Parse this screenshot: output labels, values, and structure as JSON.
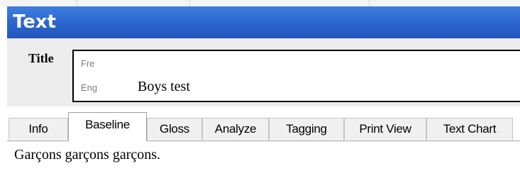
{
  "header": {
    "title": "Text"
  },
  "title_section": {
    "label": "Title",
    "rows": [
      {
        "code": "Fre",
        "value": ""
      },
      {
        "code": "Eng",
        "value": "Boys test"
      }
    ]
  },
  "tabs": [
    {
      "label": "Info",
      "active": false
    },
    {
      "label": "Baseline",
      "active": true
    },
    {
      "label": "Gloss",
      "active": false
    },
    {
      "label": "Analyze",
      "active": false
    },
    {
      "label": "Tagging",
      "active": false
    },
    {
      "label": "Print View",
      "active": false
    },
    {
      "label": "Text Chart",
      "active": false
    }
  ],
  "content": {
    "text": "Garçons garçons garçons."
  },
  "colors": {
    "header_blue": "#2a64cc",
    "panel_gray": "#ececec"
  }
}
